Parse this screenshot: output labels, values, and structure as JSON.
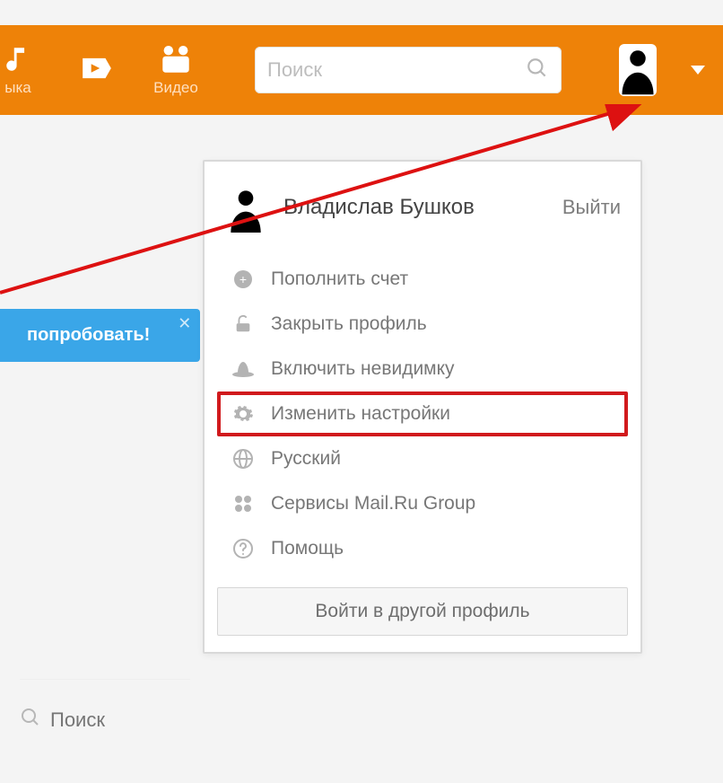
{
  "topbar": {
    "nav": [
      {
        "label": "ыка"
      },
      {
        "label": "Видео"
      }
    ],
    "search_placeholder": "Поиск"
  },
  "try_button": "попробовать!",
  "dropdown": {
    "user_name": "Владислав Бушков",
    "logout": "Выйти",
    "items": [
      {
        "label": "Пополнить счет"
      },
      {
        "label": "Закрыть профиль"
      },
      {
        "label": "Включить невидимку"
      },
      {
        "label": "Изменить настройки"
      },
      {
        "label": "Русский"
      },
      {
        "label": "Сервисы Mail.Ru Group"
      },
      {
        "label": "Помощь"
      }
    ],
    "login_other": "Войти в другой профиль"
  },
  "bottom_search": "Поиск"
}
